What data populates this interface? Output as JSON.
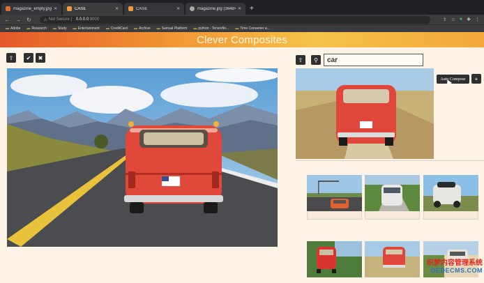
{
  "browser": {
    "tabs": [
      {
        "title": "magazine_empty.jpg (3648×2"
      },
      {
        "title": "CASE"
      },
      {
        "title": "CASE"
      },
      {
        "title": "magazine.jpg (3648×2863)"
      }
    ],
    "address": {
      "security": "Not Secure",
      "host": "0.0.0.0",
      "port": ":8000"
    },
    "bookmarks": [
      "Adobe",
      "Research",
      "Study",
      "Entertainment",
      "CreditCard",
      "Archive",
      "Samsal Platform",
      "python - Tensorflo...",
      "Time Converter a..."
    ]
  },
  "app": {
    "title": "Clever Composites",
    "search": {
      "value": "car"
    },
    "auto_compose_label": "Auto Compose",
    "icons": {
      "upload": "upload-icon",
      "confirm": "check-icon",
      "cancel": "close-icon",
      "search": "search-icon",
      "add": "plus-icon"
    }
  },
  "watermark": {
    "line1": "织梦内容管理系统",
    "line2": "DEDECMS.COM"
  },
  "colors": {
    "banner_start": "#e6592a",
    "banner_end": "#f5c248",
    "button": "#2f2f2f",
    "background": "#fdf3e6"
  }
}
